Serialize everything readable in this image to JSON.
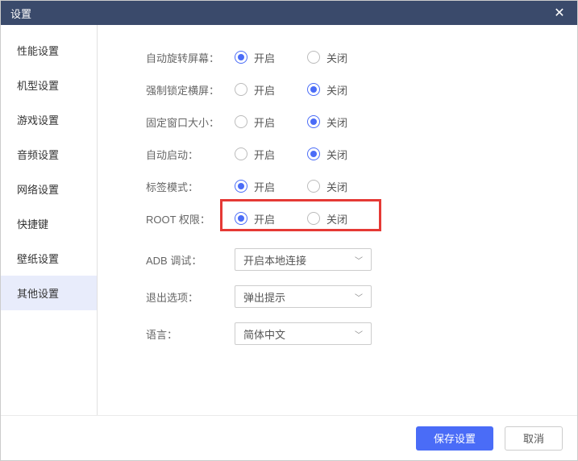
{
  "titlebar": {
    "title": "设置"
  },
  "sidebar": {
    "items": [
      {
        "label": "性能设置"
      },
      {
        "label": "机型设置"
      },
      {
        "label": "游戏设置"
      },
      {
        "label": "音频设置"
      },
      {
        "label": "网络设置"
      },
      {
        "label": "快捷键"
      },
      {
        "label": "壁纸设置"
      },
      {
        "label": "其他设置"
      }
    ],
    "activeIndex": 7
  },
  "content": {
    "radioRows": [
      {
        "label": "自动旋转屏幕：",
        "on": "开启",
        "off": "关闭",
        "value": "on"
      },
      {
        "label": "强制锁定横屏：",
        "on": "开启",
        "off": "关闭",
        "value": "off"
      },
      {
        "label": "固定窗口大小：",
        "on": "开启",
        "off": "关闭",
        "value": "off"
      },
      {
        "label": "自动启动：",
        "on": "开启",
        "off": "关闭",
        "value": "off"
      },
      {
        "label": "标签模式：",
        "on": "开启",
        "off": "关闭",
        "value": "on"
      },
      {
        "label": "ROOT 权限：",
        "on": "开启",
        "off": "关闭",
        "value": "on"
      }
    ],
    "selectRows": [
      {
        "label": "ADB 调试：",
        "value": "开启本地连接"
      },
      {
        "label": "退出选项：",
        "value": "弹出提示"
      },
      {
        "label": "语言：",
        "value": "简体中文"
      }
    ],
    "highlightRowIndex": 5
  },
  "footer": {
    "save": "保存设置",
    "cancel": "取消"
  }
}
